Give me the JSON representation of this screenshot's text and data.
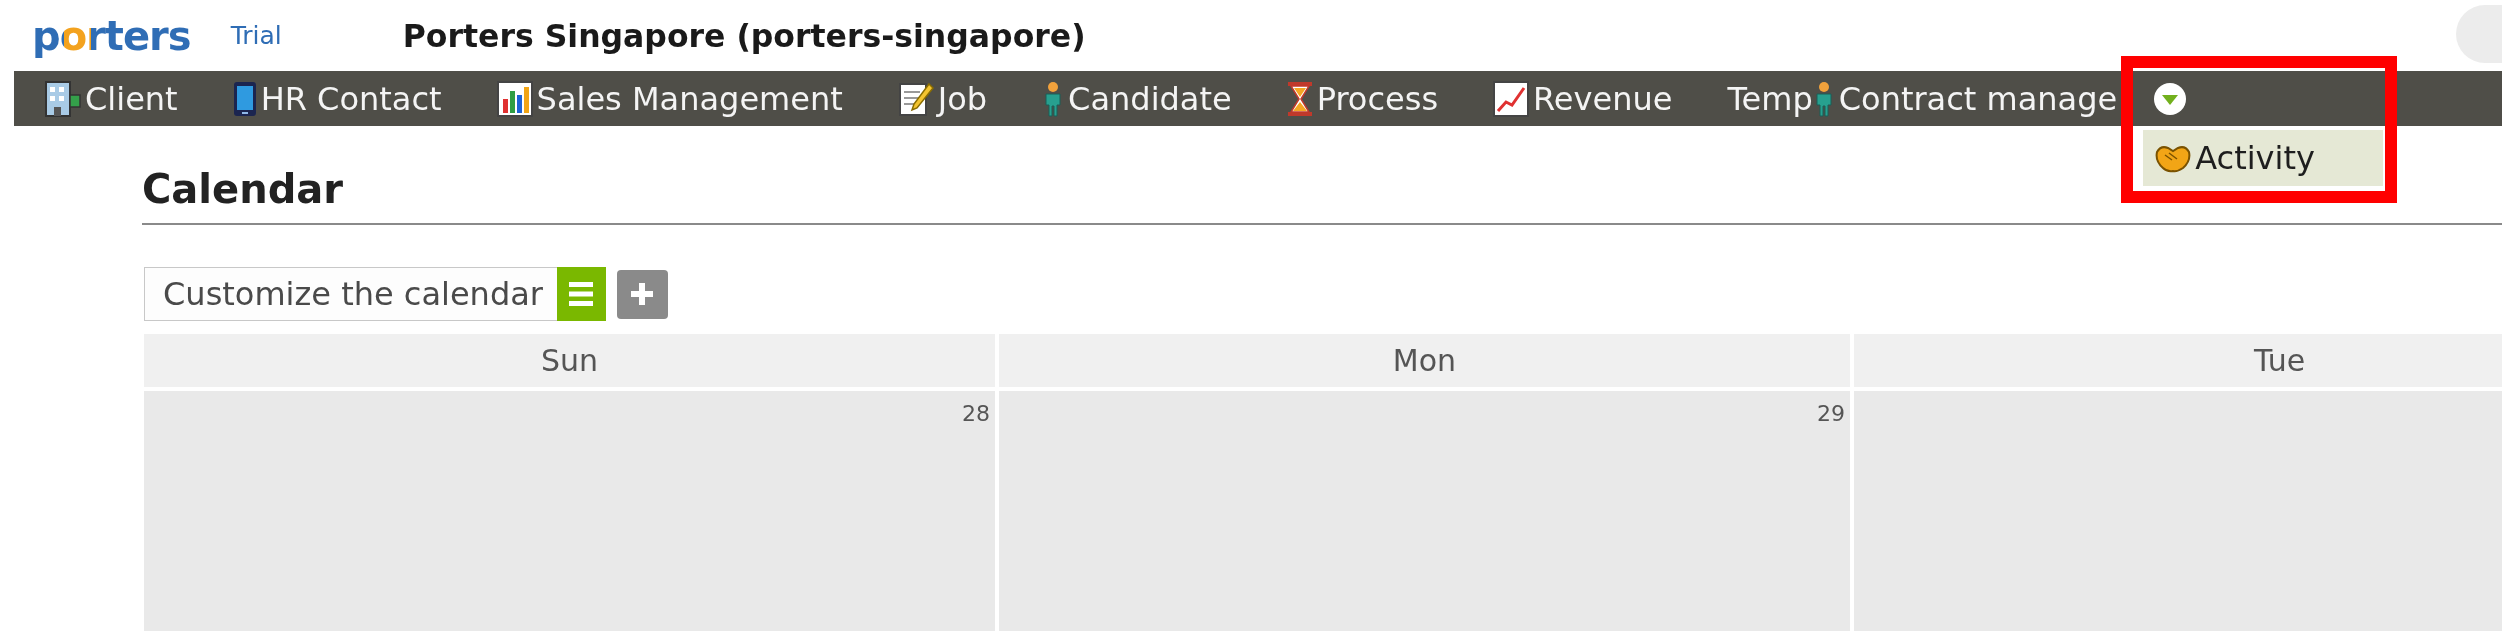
{
  "header": {
    "logo": "porters",
    "plan": "Trial",
    "title": "Porters Singapore (porters-singapore)"
  },
  "nav": {
    "items": [
      {
        "label": "Client"
      },
      {
        "label": "HR Contact"
      },
      {
        "label": "Sales Management"
      },
      {
        "label": "Job"
      },
      {
        "label": "Candidate"
      },
      {
        "label": "Process"
      },
      {
        "label": "Revenue"
      },
      {
        "label": "Temp"
      },
      {
        "label": "Contract manage"
      }
    ],
    "more_menu": {
      "expanded": true,
      "highlighted": true,
      "items": [
        {
          "label": "Activity"
        }
      ]
    }
  },
  "page": {
    "title": "Calendar"
  },
  "toolbar": {
    "calendar_select": {
      "value": "Customize the calendar"
    }
  },
  "calendar": {
    "columns": [
      {
        "label": "Sun",
        "date": "28"
      },
      {
        "label": "Mon",
        "date": "29"
      },
      {
        "label": "Tue"
      }
    ]
  }
}
